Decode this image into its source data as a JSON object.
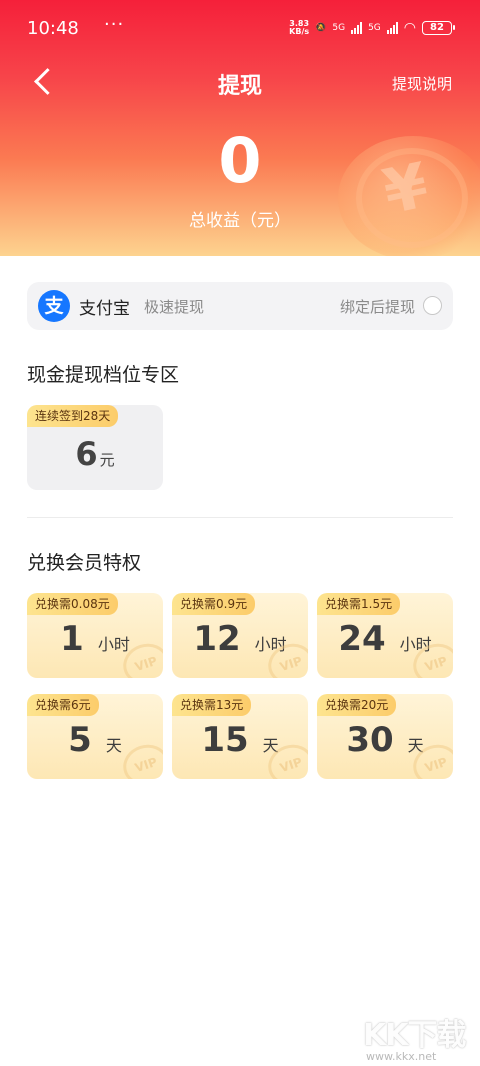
{
  "status_bar": {
    "time": "10:48",
    "dots": "···",
    "net_speed_value": "3.83",
    "net_speed_unit": "KB/s",
    "sig1": "5G",
    "sig2": "5G",
    "battery": "82"
  },
  "nav": {
    "title": "提现",
    "explain_link": "提现说明"
  },
  "earnings": {
    "total_value": "0",
    "total_label": "总收益（元）"
  },
  "payment": {
    "icon_glyph": "支",
    "name": "支付宝",
    "subtitle": "极速提现",
    "bind_text": "绑定后提现"
  },
  "cash_section": {
    "title": "现金提现档位专区",
    "tiers": [
      {
        "tag": "连续签到28天",
        "amount": "6",
        "unit": "元"
      }
    ]
  },
  "vip_section": {
    "title": "兑换会员特权",
    "cards": [
      {
        "tag": "兑换需0.08元",
        "value": "1",
        "unit": "小时"
      },
      {
        "tag": "兑换需0.9元",
        "value": "12",
        "unit": "小时"
      },
      {
        "tag": "兑换需1.5元",
        "value": "24",
        "unit": "小时"
      },
      {
        "tag": "兑换需6元",
        "value": "5",
        "unit": "天"
      },
      {
        "tag": "兑换需13元",
        "value": "15",
        "unit": "天"
      },
      {
        "tag": "兑换需20元",
        "value": "30",
        "unit": "天"
      }
    ],
    "badge_text": "VIP"
  },
  "watermark": {
    "logo": "KK下载",
    "url": "www.kkx.net"
  },
  "colors": {
    "header_top": "#f5203a",
    "header_bottom": "#fdd38f",
    "alipay_blue": "#1677ff",
    "tag_gold": "#fccc6a"
  }
}
